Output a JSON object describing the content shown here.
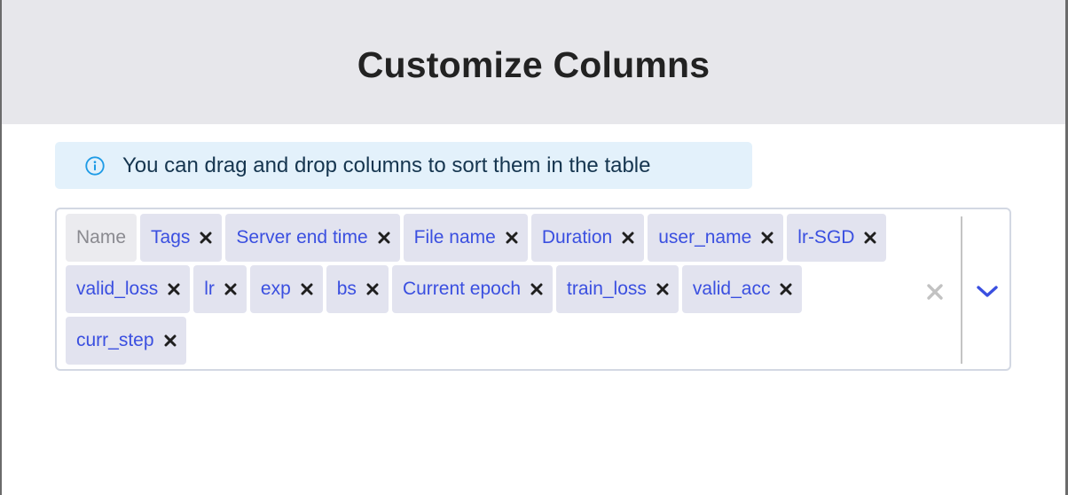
{
  "dialog": {
    "title": "Customize Columns",
    "info_icon": "info-circle-icon",
    "info_text": "You can drag and drop columns to sort them in the table"
  },
  "columns_select": {
    "fixed_column": "Name",
    "selected": [
      {
        "label": "Tags"
      },
      {
        "label": "Server end time"
      },
      {
        "label": "File name"
      },
      {
        "label": "Duration"
      },
      {
        "label": "user_name"
      },
      {
        "label": "lr-SGD"
      },
      {
        "label": "valid_loss"
      },
      {
        "label": "lr"
      },
      {
        "label": "exp"
      },
      {
        "label": "bs"
      },
      {
        "label": "Current epoch"
      },
      {
        "label": "train_loss"
      },
      {
        "label": "valid_acc"
      },
      {
        "label": "curr_step"
      }
    ],
    "remove_icon": "close-x-icon",
    "clear_icon": "clear-all-icon",
    "dropdown_icon": "chevron-down-icon"
  },
  "colors": {
    "chip_text": "#3a4fe0",
    "chip_bg": "#e2e3ef",
    "header_bg": "#e7e7eb",
    "info_bg": "#e3f1fb",
    "info_icon": "#1e9be6",
    "chevron": "#3a4fe0"
  }
}
